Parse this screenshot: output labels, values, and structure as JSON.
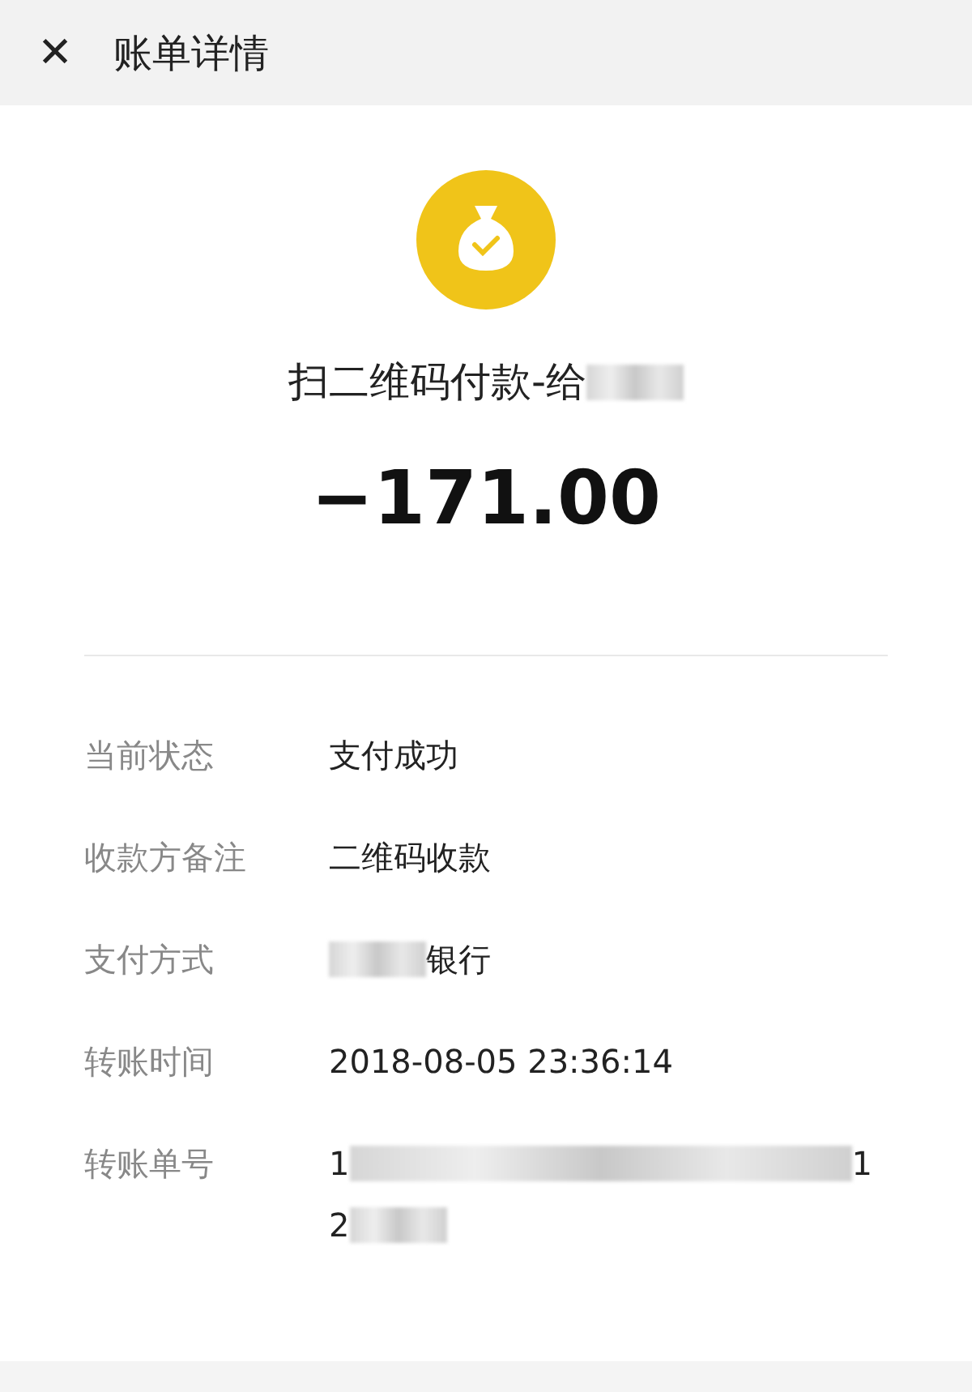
{
  "header": {
    "close_glyph": "✕",
    "title": "账单详情"
  },
  "summary": {
    "title": [
      {
        "kind": "text",
        "text": "扫二维码付款-给"
      },
      {
        "kind": "redacted"
      }
    ],
    "amount": "−171.00"
  },
  "details": [
    {
      "label": "当前状态",
      "value": [
        {
          "kind": "text",
          "text": "支付成功"
        }
      ]
    },
    {
      "label": "收款方备注",
      "value": [
        {
          "kind": "text",
          "text": "二维码收款"
        }
      ]
    },
    {
      "label": "支付方式",
      "value": [
        {
          "kind": "redacted"
        },
        {
          "kind": "text",
          "text": "银行"
        }
      ]
    },
    {
      "label": "转账时间",
      "value": [
        {
          "kind": "text",
          "text": "2018-08-05 23:36:14"
        }
      ]
    },
    {
      "label": "转账单号",
      "value": [
        {
          "kind": "text",
          "text": "1"
        },
        {
          "kind": "redacted",
          "wide": true
        },
        {
          "kind": "text",
          "text": "1"
        },
        {
          "kind": "break"
        },
        {
          "kind": "text",
          "text": "2"
        },
        {
          "kind": "redacted"
        }
      ]
    }
  ]
}
